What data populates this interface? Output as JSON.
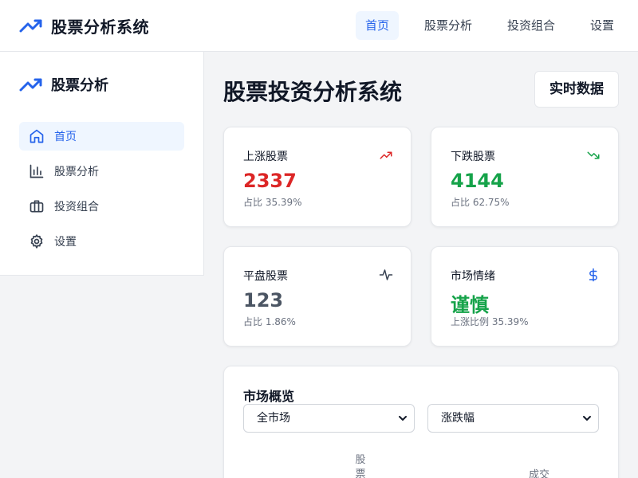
{
  "header": {
    "title": "股票分析系统",
    "nav": [
      {
        "label": "首页",
        "active": true
      },
      {
        "label": "股票分析",
        "active": false
      },
      {
        "label": "投资组合",
        "active": false
      },
      {
        "label": "设置",
        "active": false
      }
    ]
  },
  "sidebar": {
    "title": "股票分析",
    "items": [
      {
        "label": "首页",
        "icon": "home-icon",
        "active": true
      },
      {
        "label": "股票分析",
        "icon": "bar-chart-icon",
        "active": false
      },
      {
        "label": "投资组合",
        "icon": "briefcase-icon",
        "active": false
      },
      {
        "label": "设置",
        "icon": "gear-icon",
        "active": false
      }
    ]
  },
  "main": {
    "title": "股票投资分析系统",
    "realtime_label": "实时数据",
    "cards": [
      {
        "label": "上涨股票",
        "value": "2337",
        "sub": "占比 35.39%",
        "icon": "trending-up-icon",
        "color": "#dc2626"
      },
      {
        "label": "下跌股票",
        "value": "4144",
        "sub": "占比 62.75%",
        "icon": "trending-down-icon",
        "color": "#16a34a"
      },
      {
        "label": "平盘股票",
        "value": "123",
        "sub": "占比 1.86%",
        "icon": "activity-icon",
        "color": "#4b5563"
      },
      {
        "label": "市场情绪",
        "value": "谨慎",
        "sub": "上涨比例 35.39%",
        "icon": "dollar-icon",
        "color": "#16a34a"
      }
    ],
    "overview": {
      "title": "市场概览",
      "market_select": "全市场",
      "sort_select": "涨跌幅",
      "headers": [
        "股票",
        "成交"
      ]
    }
  },
  "colors": {
    "accent": "#2563eb",
    "up": "#dc2626",
    "down": "#16a34a",
    "flat": "#4b5563"
  }
}
